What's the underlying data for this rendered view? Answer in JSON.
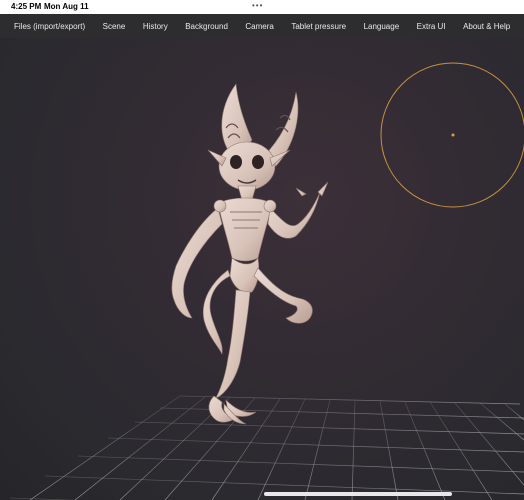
{
  "status_bar": {
    "time": "4:25 PM",
    "date": "Mon Aug 11",
    "dots": "•••"
  },
  "menu": {
    "items": [
      "Files (import/export)",
      "Scene",
      "History",
      "Background",
      "Camera",
      "Tablet pressure",
      "Language",
      "Extra UI",
      "About & Help"
    ]
  },
  "viewport": {
    "background_color": "#2a2a2f",
    "grid_color": "#8a8691",
    "brush_ring_color": "#c8913f",
    "model": "pale clay creature sculpt with horned head"
  },
  "icons": [
    "brush-radius-ring-icon",
    "multitask-dots-icon"
  ]
}
